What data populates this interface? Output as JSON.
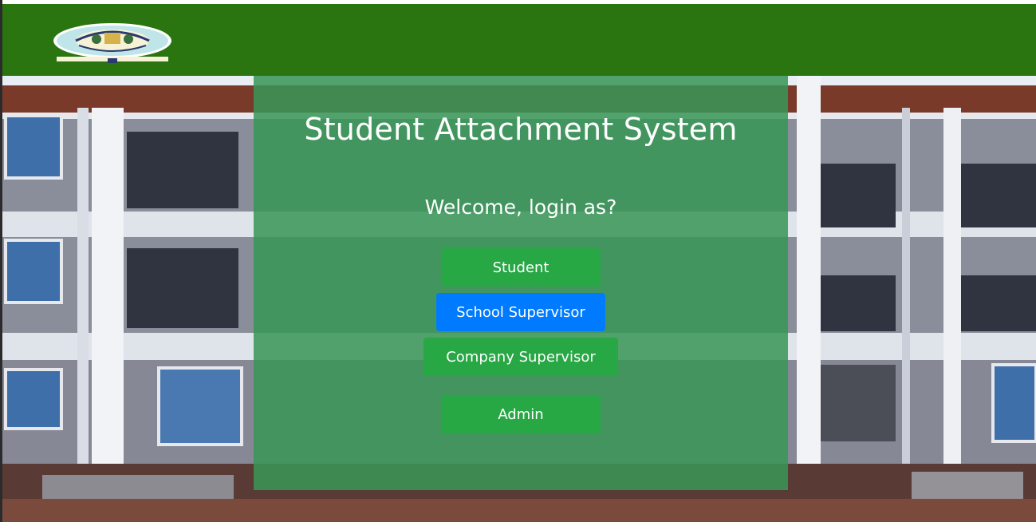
{
  "header": {
    "logo_icon": "university-crest-icon",
    "bg_color": "#2b7511"
  },
  "main": {
    "title": "Student Attachment System",
    "subtitle": "Welcome, login as?",
    "buttons": [
      {
        "label": "Student",
        "color": "#28a745"
      },
      {
        "label": "School Supervisor",
        "color": "#007bff"
      },
      {
        "label": "Company Supervisor",
        "color": "#28a745"
      },
      {
        "label": "Admin",
        "color": "#28a745"
      }
    ]
  }
}
